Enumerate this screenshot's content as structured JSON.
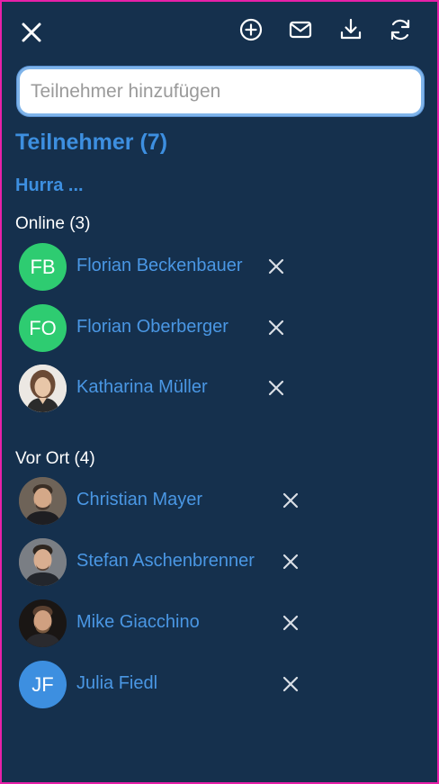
{
  "toolbar": {
    "close_icon": "close-icon",
    "icons": [
      "add-circle-icon",
      "mail-icon",
      "download-icon",
      "refresh-icon"
    ]
  },
  "search": {
    "placeholder": "Teilnehmer hinzufügen",
    "value": ""
  },
  "panel": {
    "title": "Teilnehmer (7)",
    "subtitle": "Hurra ..."
  },
  "sections": {
    "online": {
      "label": "Online (3)",
      "participants": [
        {
          "name": "Florian Beckenbauer",
          "initials": "FB",
          "avatar": "initials",
          "color": "#2ecc71"
        },
        {
          "name": "Florian Oberberger",
          "initials": "FO",
          "avatar": "initials",
          "color": "#2ecc71"
        },
        {
          "name": "Katharina Müller",
          "initials": "",
          "avatar": "photo",
          "color": "#e8e2da"
        }
      ]
    },
    "onsite": {
      "label": "Vor Ort (4)",
      "participants": [
        {
          "name": "Christian Mayer",
          "initials": "",
          "avatar": "photo",
          "color": "#5a5046"
        },
        {
          "name": "Stefan Aschenbrenner",
          "initials": "",
          "avatar": "photo",
          "color": "#6a6e74"
        },
        {
          "name": "Mike Giacchino",
          "initials": "",
          "avatar": "photo",
          "color": "#2a2522"
        },
        {
          "name": "Julia Fiedl",
          "initials": "JF",
          "avatar": "initials",
          "color": "#3d8fe0"
        }
      ]
    }
  },
  "colors": {
    "background": "#15304d",
    "accent": "#3d8fe0",
    "frame_border": "#e620a8",
    "online_green": "#2ecc71"
  }
}
